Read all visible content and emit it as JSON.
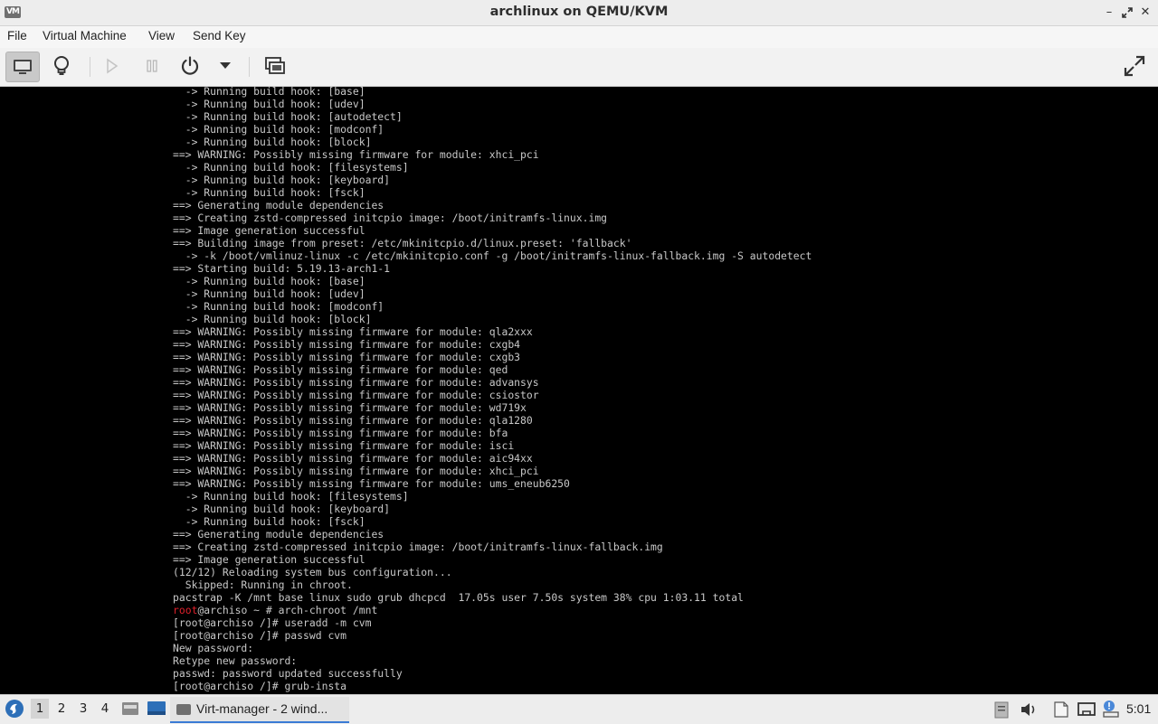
{
  "window": {
    "title": "archlinux on QEMU/KVM",
    "app_icon_text": "VM"
  },
  "menubar": {
    "items": [
      "File",
      "Virtual Machine",
      "View",
      "Send Key"
    ]
  },
  "toolbar": {
    "buttons": [
      "console-icon",
      "details-lightbulb-icon",
      "run-icon",
      "pause-icon",
      "power-icon",
      "power-menu-chevron-icon",
      "snapshots-icon",
      "fullscreen-icon"
    ]
  },
  "console": {
    "lines": [
      "  -> Running build hook: [base]",
      "  -> Running build hook: [udev]",
      "  -> Running build hook: [autodetect]",
      "  -> Running build hook: [modconf]",
      "  -> Running build hook: [block]",
      "==> WARNING: Possibly missing firmware for module: xhci_pci",
      "  -> Running build hook: [filesystems]",
      "  -> Running build hook: [keyboard]",
      "  -> Running build hook: [fsck]",
      "==> Generating module dependencies",
      "==> Creating zstd-compressed initcpio image: /boot/initramfs-linux.img",
      "==> Image generation successful",
      "==> Building image from preset: /etc/mkinitcpio.d/linux.preset: 'fallback'",
      "  -> -k /boot/vmlinuz-linux -c /etc/mkinitcpio.conf -g /boot/initramfs-linux-fallback.img -S autodetect",
      "==> Starting build: 5.19.13-arch1-1",
      "  -> Running build hook: [base]",
      "  -> Running build hook: [udev]",
      "  -> Running build hook: [modconf]",
      "  -> Running build hook: [block]",
      "==> WARNING: Possibly missing firmware for module: qla2xxx",
      "==> WARNING: Possibly missing firmware for module: cxgb4",
      "==> WARNING: Possibly missing firmware for module: cxgb3",
      "==> WARNING: Possibly missing firmware for module: qed",
      "==> WARNING: Possibly missing firmware for module: advansys",
      "==> WARNING: Possibly missing firmware for module: csiostor",
      "==> WARNING: Possibly missing firmware for module: wd719x",
      "==> WARNING: Possibly missing firmware for module: qla1280",
      "==> WARNING: Possibly missing firmware for module: bfa",
      "==> WARNING: Possibly missing firmware for module: isci",
      "==> WARNING: Possibly missing firmware for module: aic94xx",
      "==> WARNING: Possibly missing firmware for module: xhci_pci",
      "==> WARNING: Possibly missing firmware for module: ums_eneub6250",
      "  -> Running build hook: [filesystems]",
      "  -> Running build hook: [keyboard]",
      "  -> Running build hook: [fsck]",
      "==> Generating module dependencies",
      "==> Creating zstd-compressed initcpio image: /boot/initramfs-linux-fallback.img",
      "==> Image generation successful",
      "(12/12) Reloading system bus configuration...",
      "  Skipped: Running in chroot.",
      "pacstrap -K /mnt base linux sudo grub dhcpcd  17.05s user 7.50s system 38% cpu 1:03.11 total",
      "[root@archiso /]# useradd -m cvm",
      "[root@archiso /]# passwd cvm",
      "New password:",
      "Retype new password:",
      "passwd: password updated successfully",
      "[root@archiso /]# grub-insta"
    ],
    "red_prompt": {
      "user": "root",
      "rest": "@archiso ~ # arch-chroot /mnt"
    }
  },
  "taskbar": {
    "workspaces": [
      "1",
      "2",
      "3",
      "4"
    ],
    "active_workspace": "1",
    "task_label": "Virt-manager - 2 wind...",
    "clock": "5:01"
  },
  "colors": {
    "console_bg": "#000000",
    "console_fg": "#c8c8c8",
    "prompt_red": "#e0202b",
    "accent": "#3a7bd5"
  }
}
